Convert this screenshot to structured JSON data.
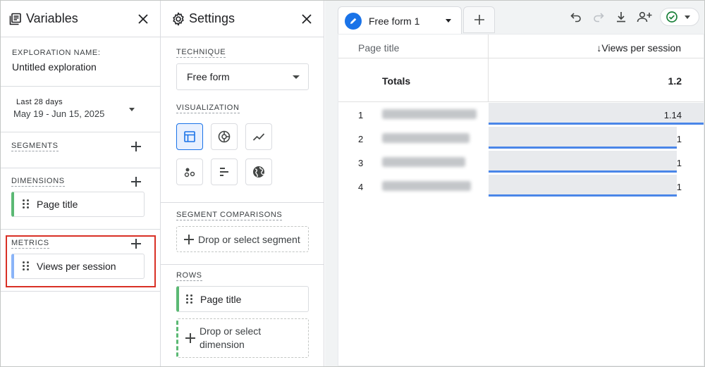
{
  "variables": {
    "title": "Variables",
    "exploration_label": "EXPLORATION NAME:",
    "exploration_name": "Untitled exploration",
    "date_label": "Last 28 days",
    "date_range": "May 19 - Jun 15, 2025",
    "segments_label": "SEGMENTS",
    "dimensions_label": "DIMENSIONS",
    "dimension_chip": "Page title",
    "metrics_label": "METRICS",
    "metric_chip": "Views per session"
  },
  "settings": {
    "title": "Settings",
    "technique_label": "TECHNIQUE",
    "technique_value": "Free form",
    "visualization_label": "VISUALIZATION",
    "visualization_icons": [
      "table-icon",
      "donut-chart-icon",
      "line-chart-icon",
      "scatter-chart-icon",
      "bar-chart-icon",
      "geo-map-icon"
    ],
    "segment_comparisons_label": "SEGMENT COMPARISONS",
    "segment_drop": "Drop or select segment",
    "rows_label": "ROWS",
    "row_chip": "Page title",
    "dimension_drop_line1": "Drop or select",
    "dimension_drop_line2": "dimension"
  },
  "canvas": {
    "tab_label": "Free form 1",
    "toolbar_icons": [
      "undo-icon",
      "redo-icon",
      "download-icon",
      "share-user-icon",
      "check-circle-icon"
    ],
    "table": {
      "dim_header": "Page title",
      "metric_header": "↓Views per session",
      "totals_label": "Totals",
      "totals_value": "1.2",
      "rows": [
        {
          "index": "1",
          "value": "1.14",
          "fill": 1.0
        },
        {
          "index": "2",
          "value": "1",
          "fill": 0.877
        },
        {
          "index": "3",
          "value": "1",
          "fill": 0.877
        },
        {
          "index": "4",
          "value": "1",
          "fill": 0.877
        }
      ]
    }
  },
  "colors": {
    "accent": "#1a73e8",
    "dimension_green": "#5bb974",
    "metric_blue": "#8ab4f8",
    "highlight_red": "#d93025",
    "bar_line": "#4a86e8"
  }
}
